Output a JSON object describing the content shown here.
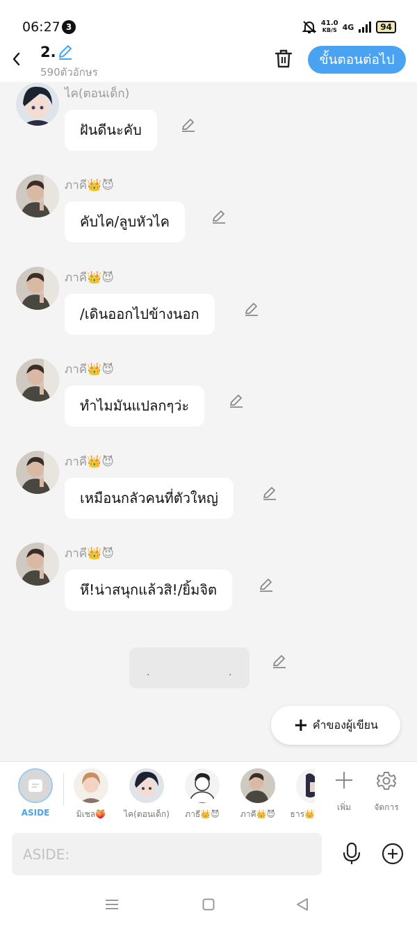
{
  "status": {
    "time": "06:27",
    "notification_count": "3",
    "net_speed_value": "41.0",
    "net_speed_unit": "KB/S",
    "network": "4G",
    "battery": "94"
  },
  "header": {
    "title": "2.",
    "char_count": "590ตัวอักษร",
    "next_label": "ขั้นตอนต่อไป"
  },
  "messages": [
    {
      "name": "ไค(ตอนเด็ก)",
      "text": "ฝันดีนะคับ",
      "avatar": "boy-avatar"
    },
    {
      "name": "ภาคี👑😈",
      "text": "คับไค/ลูบหัวไค",
      "avatar": "man-avatar"
    },
    {
      "name": "ภาคี👑😈",
      "text": "/เดินออกไปข้างนอก",
      "avatar": "man-avatar"
    },
    {
      "name": "ภาคี👑😈",
      "text": "ทำไมมันแปลกๆว่ะ",
      "avatar": "man-avatar"
    },
    {
      "name": "ภาคี👑😈",
      "text": "เหมือนกลัวคนที่ตัวใหญ่",
      "avatar": "man-avatar"
    },
    {
      "name": "ภาคี👑😈",
      "text": "หึ!น่าสนุกแล้วสิ!/ยิ้มจิต",
      "avatar": "man-avatar"
    }
  ],
  "placeholder_bubble": {
    "left_dot": ".",
    "right_dot": "."
  },
  "author_note_label": "คำของผู้เขียน",
  "character_bar": {
    "aside_label": "ASIDE",
    "characters": [
      {
        "label": "มิเชล🍑",
        "avatar": "blonde-avatar"
      },
      {
        "label": "ไค(ตอนเด็ก)",
        "avatar": "boy-avatar"
      },
      {
        "label": "ภาธี👑😈",
        "avatar": "sketch-avatar"
      },
      {
        "label": "ภาคี👑😈",
        "avatar": "man-avatar"
      },
      {
        "label": "ธาร👑",
        "avatar": "partial-avatar"
      }
    ],
    "add_label": "เพิ่ม",
    "manage_label": "จัดการ"
  },
  "input": {
    "placeholder": "ASIDE:"
  },
  "colors": {
    "accent": "#4aa3f1",
    "background": "#f4f4f4",
    "bubble": "#ffffff"
  }
}
